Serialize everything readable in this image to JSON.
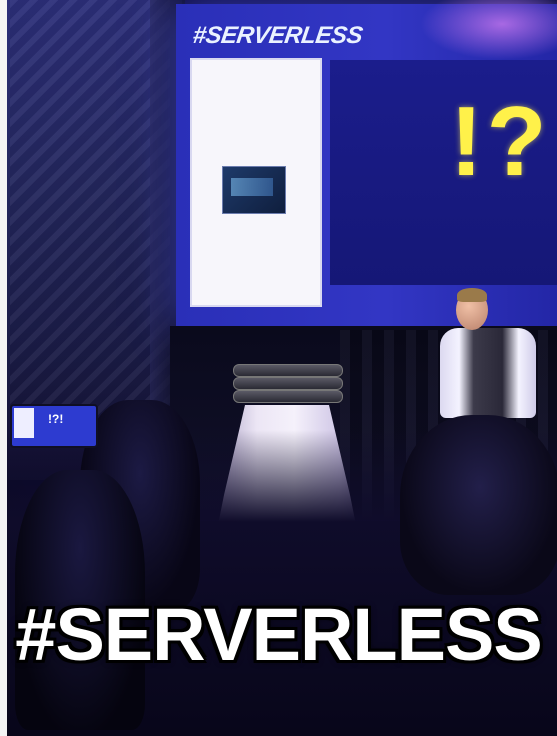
{
  "slide": {
    "title": "#SERVERLESS",
    "marks": "!?"
  },
  "phone": {
    "screen_text": "!?!"
  },
  "caption": {
    "text": "#SERVERLESS"
  },
  "colors": {
    "stage_blue": "#2a2fb8",
    "accent_yellow": "#fff14a",
    "caption_white": "#ffffff",
    "caption_outline": "#000000"
  }
}
